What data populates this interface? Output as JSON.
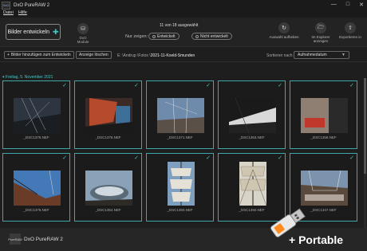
{
  "window": {
    "title": "DxO PureRAW 2",
    "logo": "DxO"
  },
  "menu": [
    "Datei",
    "Hilfe"
  ],
  "toolbar": {
    "develop_label": "Bilder entwickeln",
    "module_label": "DxO Module",
    "count_text": "11 von 18 ausgewählt",
    "filter_label": "Nur zeigen:",
    "filter_developed": "Entwickelt",
    "filter_not_developed": "Nicht entwickelt",
    "actions": [
      "Auswahl aufheben",
      "Im Explorer anzeigen",
      "Exportieren in"
    ]
  },
  "subbar": {
    "add_label": "Bilder hinzufügen zum Entwickeln",
    "clear_label": "Anzeige löschen",
    "path_prefix": "E: \\Andrup \\Fotos \\",
    "path_folder": "2021-11-Koeld-Smunden",
    "sort_label": "Sortieren nach",
    "sort_value": "Aufnahmedatum"
  },
  "group_header": "Freitag, 5. November 2021",
  "thumbnails": [
    {
      "filename": "_DSC1375.NEF",
      "checked": true
    },
    {
      "filename": "_DSC1376.NEF",
      "checked": true
    },
    {
      "filename": "_DSC1371.NEF",
      "checked": true
    },
    {
      "filename": "_DSC1363.NEF",
      "checked": true
    },
    {
      "filename": "_DSC1358.NEF",
      "checked": true
    },
    {
      "filename": "_DSC1376.NEF",
      "checked": true
    },
    {
      "filename": "_DSC1364.NEF",
      "checked": true
    },
    {
      "filename": "_DSC1360.NEF",
      "checked": true
    },
    {
      "filename": "_DSC1350.NEF",
      "checked": true
    },
    {
      "filename": "_DSC1347.NEF",
      "checked": true
    }
  ],
  "footer": {
    "logo": "PureRAW",
    "product": "DxO PureRAW 2"
  },
  "overlay": {
    "portable_text": "+ Portable"
  },
  "colors": {
    "accent": "#3fc7c9",
    "background": "#1e1e1e"
  }
}
